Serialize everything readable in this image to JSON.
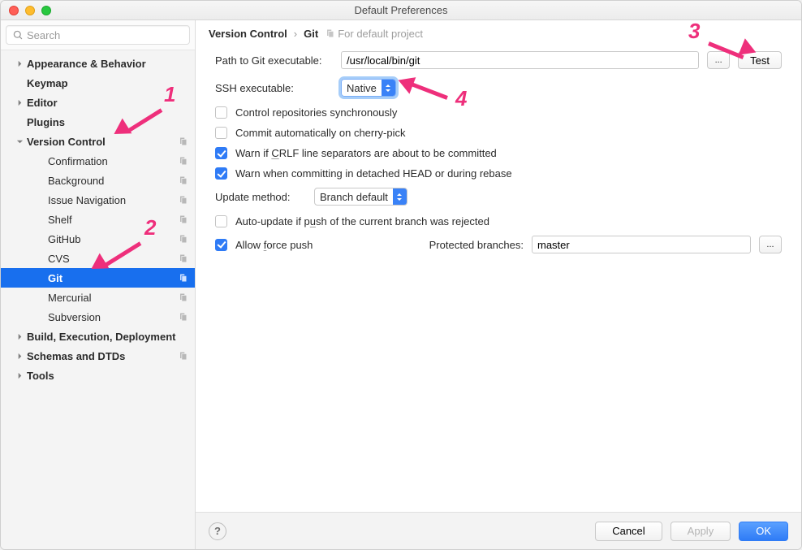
{
  "window": {
    "title": "Default Preferences"
  },
  "search": {
    "placeholder": "Search"
  },
  "tree": {
    "top": [
      {
        "label": "Appearance & Behavior",
        "caret": "right",
        "bold": true
      },
      {
        "label": "Keymap",
        "caret": "none",
        "bold": true
      },
      {
        "label": "Editor",
        "caret": "right",
        "bold": true
      },
      {
        "label": "Plugins",
        "caret": "none",
        "bold": true
      },
      {
        "label": "Version Control",
        "caret": "down",
        "bold": true,
        "badge": true
      }
    ],
    "vcs": [
      {
        "label": "Confirmation",
        "badge": true
      },
      {
        "label": "Background",
        "badge": true
      },
      {
        "label": "Issue Navigation",
        "badge": true
      },
      {
        "label": "Shelf",
        "badge": true
      },
      {
        "label": "GitHub",
        "badge": true
      },
      {
        "label": "CVS",
        "badge": true
      },
      {
        "label": "Git",
        "badge": true,
        "selected": true
      },
      {
        "label": "Mercurial",
        "badge": true
      },
      {
        "label": "Subversion",
        "badge": true
      }
    ],
    "bottom": [
      {
        "label": "Build, Execution, Deployment",
        "caret": "right",
        "bold": true
      },
      {
        "label": "Schemas and DTDs",
        "caret": "right",
        "bold": true,
        "badge": true
      },
      {
        "label": "Tools",
        "caret": "right",
        "bold": true
      }
    ]
  },
  "breadcrumb": {
    "a": "Version Control",
    "b": "Git",
    "meta": "For default project"
  },
  "form": {
    "path_label": "Path to Git executable:",
    "path_value": "/usr/local/bin/git",
    "browse_label": "...",
    "test_label": "Test",
    "ssh_label": "SSH executable:",
    "ssh_value": "Native",
    "cb_sync": "Control repositories synchronously",
    "cb_cherry": "Commit automatically on cherry-pick",
    "cb_crlf_pre": "Warn if ",
    "cb_crlf_u": "C",
    "cb_crlf_post": "RLF line separators are about to be committed",
    "cb_detached": "Warn when committing in detached HEAD or during rebase",
    "update_label": "Update method:",
    "update_value": "Branch default",
    "cb_autopush_pre": "Auto-update if p",
    "cb_autopush_u": "u",
    "cb_autopush_post": "sh of the current branch was rejected",
    "cb_force_pre": "Allow ",
    "cb_force_u": "f",
    "cb_force_post": "orce push",
    "protected_label": "Protected branches:",
    "protected_value": "master"
  },
  "footer": {
    "cancel": "Cancel",
    "apply": "Apply",
    "ok": "OK"
  },
  "annotations": {
    "n1": "1",
    "n2": "2",
    "n3": "3",
    "n4": "4"
  }
}
